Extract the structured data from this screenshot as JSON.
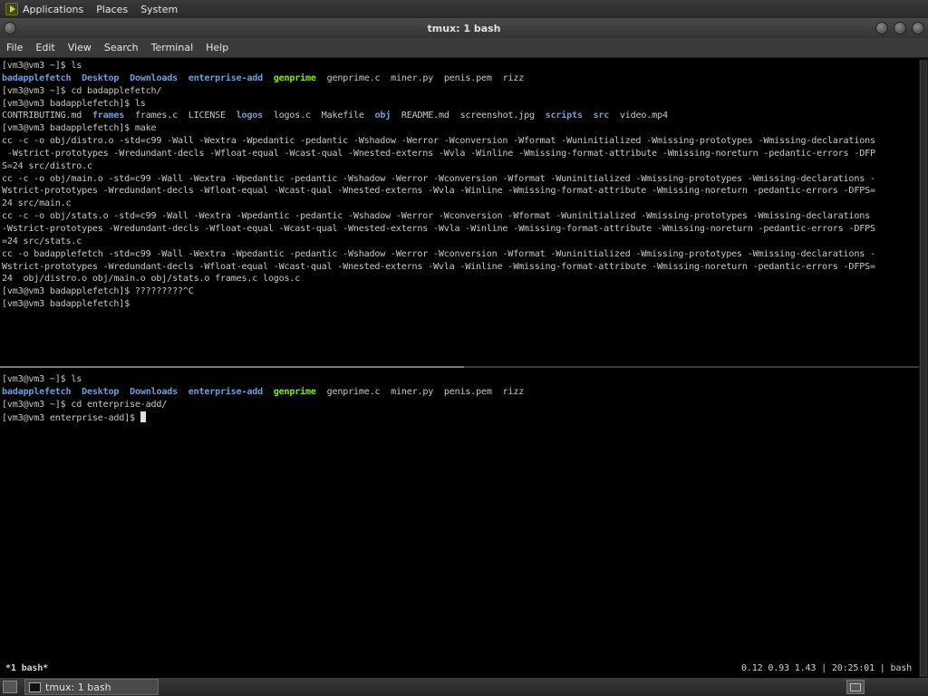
{
  "top_panel": {
    "menus": [
      "Applications",
      "Places",
      "System"
    ],
    "icon": "gnome-foot-icon"
  },
  "window": {
    "title": "tmux: 1 bash",
    "menu": [
      "File",
      "Edit",
      "View",
      "Search",
      "Terminal",
      "Help"
    ]
  },
  "colors": {
    "background": "#000000",
    "text": "#c8c8c8",
    "directory": "#6f9fd8",
    "executable": "#8ae234"
  },
  "top_pane": {
    "lines": [
      {
        "segs": [
          {
            "t": "[vm3@vm3 ~]$ ls",
            "c": "file"
          }
        ]
      },
      {
        "segs": [
          {
            "t": "badapplefetch",
            "c": "dir"
          },
          {
            "t": "  "
          },
          {
            "t": "Desktop",
            "c": "dir"
          },
          {
            "t": "  "
          },
          {
            "t": "Downloads",
            "c": "dir"
          },
          {
            "t": "  "
          },
          {
            "t": "enterprise-add",
            "c": "dir"
          },
          {
            "t": "  "
          },
          {
            "t": "genprime",
            "c": "exe"
          },
          {
            "t": "  "
          },
          {
            "t": "genprime.c",
            "c": "file"
          },
          {
            "t": "  "
          },
          {
            "t": "miner.py",
            "c": "file"
          },
          {
            "t": "  "
          },
          {
            "t": "penis.pem",
            "c": "file"
          },
          {
            "t": "  "
          },
          {
            "t": "rizz",
            "c": "file"
          }
        ]
      },
      {
        "segs": [
          {
            "t": "[vm3@vm3 ~]$ cd badapplefetch/",
            "c": "file"
          }
        ]
      },
      {
        "segs": [
          {
            "t": "[vm3@vm3 badapplefetch]$ ls",
            "c": "file"
          }
        ]
      },
      {
        "segs": [
          {
            "t": "CONTRIBUTING.md",
            "c": "file"
          },
          {
            "t": "  "
          },
          {
            "t": "frames",
            "c": "dir"
          },
          {
            "t": "  "
          },
          {
            "t": "frames.c",
            "c": "file"
          },
          {
            "t": "  "
          },
          {
            "t": "LICENSE",
            "c": "file"
          },
          {
            "t": "  "
          },
          {
            "t": "logos",
            "c": "dir"
          },
          {
            "t": "  "
          },
          {
            "t": "logos.c",
            "c": "file"
          },
          {
            "t": "  "
          },
          {
            "t": "Makefile",
            "c": "file"
          },
          {
            "t": "  "
          },
          {
            "t": "obj",
            "c": "dir"
          },
          {
            "t": "  "
          },
          {
            "t": "README.md",
            "c": "file"
          },
          {
            "t": "  "
          },
          {
            "t": "screenshot.jpg",
            "c": "file"
          },
          {
            "t": "  "
          },
          {
            "t": "scripts",
            "c": "dir"
          },
          {
            "t": "  "
          },
          {
            "t": "src",
            "c": "dir"
          },
          {
            "t": "  "
          },
          {
            "t": "video.mp4",
            "c": "file"
          }
        ]
      },
      {
        "segs": [
          {
            "t": "[vm3@vm3 badapplefetch]$ make",
            "c": "file"
          }
        ]
      },
      {
        "segs": [
          {
            "t": "cc -c -o obj/distro.o -std=c99 -Wall -Wextra -Wpedantic -pedantic -Wshadow -Werror -Wconversion -Wformat -Wuninitialized -Wmissing-prototypes -Wmissing-declarations",
            "c": "file"
          }
        ]
      },
      {
        "segs": [
          {
            "t": " -Wstrict-prototypes -Wredundant-decls -Wfloat-equal -Wcast-qual -Wnested-externs -Wvla -Winline -Wmissing-format-attribute -Wmissing-noreturn -pedantic-errors -DFP",
            "c": "file"
          }
        ]
      },
      {
        "segs": [
          {
            "t": "S=24 src/distro.c",
            "c": "file"
          }
        ]
      },
      {
        "segs": [
          {
            "t": "cc -c -o obj/main.o -std=c99 -Wall -Wextra -Wpedantic -pedantic -Wshadow -Werror -Wconversion -Wformat -Wuninitialized -Wmissing-prototypes -Wmissing-declarations -",
            "c": "file"
          }
        ]
      },
      {
        "segs": [
          {
            "t": "Wstrict-prototypes -Wredundant-decls -Wfloat-equal -Wcast-qual -Wnested-externs -Wvla -Winline -Wmissing-format-attribute -Wmissing-noreturn -pedantic-errors -DFPS=",
            "c": "file"
          }
        ]
      },
      {
        "segs": [
          {
            "t": "24 src/main.c",
            "c": "file"
          }
        ]
      },
      {
        "segs": [
          {
            "t": "cc -c -o obj/stats.o -std=c99 -Wall -Wextra -Wpedantic -pedantic -Wshadow -Werror -Wconversion -Wformat -Wuninitialized -Wmissing-prototypes -Wmissing-declarations",
            "c": "file"
          }
        ]
      },
      {
        "segs": [
          {
            "t": "-Wstrict-prototypes -Wredundant-decls -Wfloat-equal -Wcast-qual -Wnested-externs -Wvla -Winline -Wmissing-format-attribute -Wmissing-noreturn -pedantic-errors -DFPS",
            "c": "file"
          }
        ]
      },
      {
        "segs": [
          {
            "t": "=24 src/stats.c",
            "c": "file"
          }
        ]
      },
      {
        "segs": [
          {
            "t": "cc -o badapplefetch -std=c99 -Wall -Wextra -Wpedantic -pedantic -Wshadow -Werror -Wconversion -Wformat -Wuninitialized -Wmissing-prototypes -Wmissing-declarations -",
            "c": "file"
          }
        ]
      },
      {
        "segs": [
          {
            "t": "Wstrict-prototypes -Wredundant-decls -Wfloat-equal -Wcast-qual -Wnested-externs -Wvla -Winline -Wmissing-format-attribute -Wmissing-noreturn -pedantic-errors -DFPS=",
            "c": "file"
          }
        ]
      },
      {
        "segs": [
          {
            "t": "24  obj/distro.o obj/main.o obj/stats.o frames.c logos.c",
            "c": "file"
          }
        ]
      },
      {
        "segs": [
          {
            "t": "[vm3@vm3 badapplefetch]$ ?????????^C",
            "c": "file"
          }
        ]
      },
      {
        "segs": [
          {
            "t": "[vm3@vm3 badapplefetch]$",
            "c": "file"
          }
        ]
      }
    ]
  },
  "bottom_pane": {
    "lines": [
      {
        "segs": [
          {
            "t": "[vm3@vm3 ~]$ ls",
            "c": "file"
          }
        ]
      },
      {
        "segs": [
          {
            "t": "badapplefetch",
            "c": "dir"
          },
          {
            "t": "  "
          },
          {
            "t": "Desktop",
            "c": "dir"
          },
          {
            "t": "  "
          },
          {
            "t": "Downloads",
            "c": "dir"
          },
          {
            "t": "  "
          },
          {
            "t": "enterprise-add",
            "c": "dir"
          },
          {
            "t": "  "
          },
          {
            "t": "genprime",
            "c": "exe"
          },
          {
            "t": "  "
          },
          {
            "t": "genprime.c",
            "c": "file"
          },
          {
            "t": "  "
          },
          {
            "t": "miner.py",
            "c": "file"
          },
          {
            "t": "  "
          },
          {
            "t": "penis.pem",
            "c": "file"
          },
          {
            "t": "  "
          },
          {
            "t": "rizz",
            "c": "file"
          }
        ]
      },
      {
        "segs": [
          {
            "t": "[vm3@vm3 ~]$ cd enterprise-add/",
            "c": "file"
          }
        ]
      },
      {
        "segs": [
          {
            "t": "[vm3@vm3 enterprise-add]$ ",
            "c": "file"
          }
        ],
        "cursor": true
      }
    ]
  },
  "status": {
    "window_label": "*1 bash*",
    "right": "0.12 0.93 1.43 | 20:25:01 | bash"
  },
  "taskbar": {
    "task_label": "tmux: 1 bash"
  }
}
